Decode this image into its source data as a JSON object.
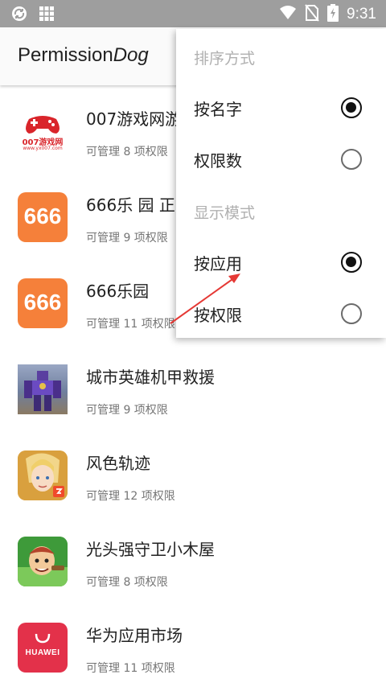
{
  "status_bar": {
    "time": "9:31",
    "icons": [
      "sync-icon",
      "grid-icon",
      "wifi-icon",
      "no-sim-icon",
      "battery-icon"
    ]
  },
  "app_bar": {
    "title_prefix": "Permission",
    "title_suffix": "Dog"
  },
  "apps": [
    {
      "name": "007游戏网游",
      "perm": "可管理 8 项权限",
      "icon": "gamepad-icon",
      "icon_caption": "007游戏网",
      "icon_sub": "www.yx007.com"
    },
    {
      "name": "666乐 园 正",
      "perm": "可管理 9 项权限",
      "icon": "666-icon",
      "icon_text": "666"
    },
    {
      "name": "666乐园",
      "perm": "可管理 11 项权限",
      "icon": "666-icon",
      "icon_text": "666"
    },
    {
      "name": "城市英雄机甲救援",
      "perm": "可管理 9 项权限",
      "icon": "robot-icon"
    },
    {
      "name": "风色轨迹",
      "perm": "可管理 12 项权限",
      "icon": "anime-character-icon"
    },
    {
      "name": "光头强守卫小木屋",
      "perm": "可管理 8 项权限",
      "icon": "cartoon-character-icon"
    },
    {
      "name": "华为应用市场",
      "perm": "可管理 11 项权限",
      "icon": "huawei-icon",
      "icon_text": "HUAWEI"
    }
  ],
  "menu": {
    "sort_header": "排序方式",
    "sort_by_name": "按名字",
    "sort_by_count": "权限数",
    "display_header": "显示模式",
    "display_by_app": "按应用",
    "display_by_perm": "按权限",
    "selected_sort": "按名字",
    "selected_display": "按应用"
  },
  "colors": {
    "status_bar": "#9e9e9e",
    "icon_666": "#f5803a",
    "huawei_red": "#e3314a",
    "annotation_arrow": "#e53935"
  }
}
